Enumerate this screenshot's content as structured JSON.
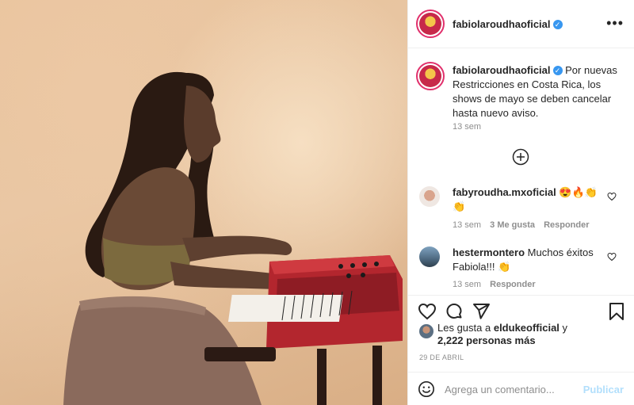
{
  "post": {
    "photo_alt": "",
    "author": "fabiolaroudhaoficial",
    "verified": true,
    "caption": "Por nuevas Restricciones en Costa Rica, los shows de mayo se deben cancelar hasta nuevo aviso.",
    "caption_time": "13 sem",
    "likes_prefix": "Les gusta a",
    "likes_user": "eldukeofficial",
    "likes_and": "y",
    "likes_count": "2,222 personas más",
    "date": "29 DE ABRIL"
  },
  "comments": [
    {
      "user": "fabyroudha.mxoficial",
      "text": "😍🔥👏👏",
      "time": "13 sem",
      "likes": "3 Me gusta",
      "reply": "Responder"
    },
    {
      "user": "hestermontero",
      "text": "Muchos éxitos Fabiola!!! 👏",
      "time": "13 sem",
      "reply": "Responder"
    }
  ],
  "add_comment": {
    "placeholder": "Agrega un comentario...",
    "post_label": "Publicar"
  },
  "icons": {
    "more": "more-options-icon",
    "load_more": "plus-circle-icon",
    "like": "heart-icon",
    "comment": "comment-icon",
    "share": "send-icon",
    "save": "bookmark-icon",
    "emoji": "emoji-icon"
  },
  "colors": {
    "verified": "#3897f0",
    "publish_disabled": "#b2dffc",
    "meta": "#8e8e8e"
  }
}
